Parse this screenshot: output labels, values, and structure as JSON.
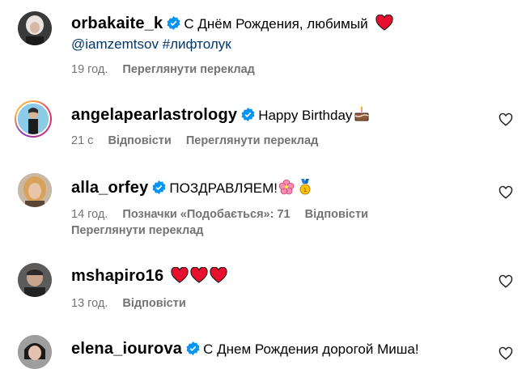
{
  "colors": {
    "muted": "#737373",
    "verified": "#0095f6",
    "heart": "#ed4956",
    "link": "#00376b"
  },
  "comments": [
    {
      "username": "orbakaite_k",
      "text": "С Днём Рождения, любимый",
      "emoji": "red-heart",
      "line2": "@iamzemtsov #лифтолук",
      "time": "19 год.",
      "see_translation": "Переглянути переклад"
    },
    {
      "username": "angelapearlastrology",
      "text": "Happy Birthday",
      "emoji": "birthday-cake",
      "time": "21 с",
      "reply": "Відповісти",
      "see_translation": "Переглянути переклад"
    },
    {
      "username": "alla_orfey",
      "text": "ПОЗДРАВЛЯЕМ!",
      "emoji": "hibiscus, medal",
      "time": "14 год.",
      "likes": "Позначки «Подобається»: 71",
      "reply": "Відповісти",
      "see_translation": "Переглянути переклад"
    },
    {
      "username": "mshapiro16",
      "text": "",
      "emoji": "three red hearts",
      "time": "13 год.",
      "reply": "Відповісти"
    },
    {
      "username": "elena_iourova",
      "text": "С Днем Рождения дорогой Миша!"
    }
  ]
}
